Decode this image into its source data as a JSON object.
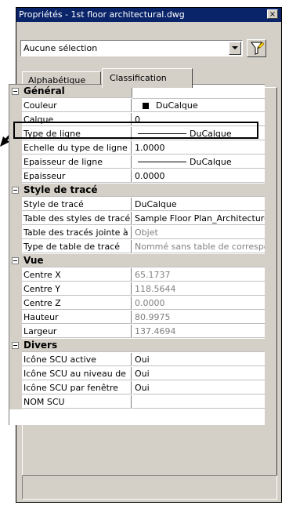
{
  "window": {
    "title": "Propriétés - 1st floor architectural.dwg",
    "close_glyph": "×"
  },
  "selection": {
    "value": "Aucune sélection"
  },
  "tabs": [
    {
      "label": "Alphabétique",
      "active": false
    },
    {
      "label": "Classification",
      "active": true
    }
  ],
  "categories": [
    {
      "label": "Général",
      "rows": [
        {
          "name": "Couleur",
          "value": "DuCalque",
          "kind": "color"
        },
        {
          "name": "Calque",
          "value": "0"
        },
        {
          "name": "Type de ligne",
          "value": "DuCalque",
          "kind": "line"
        },
        {
          "name": "Echelle du type de ligne",
          "value": "1.0000"
        },
        {
          "name": "Epaisseur de ligne",
          "value": "DuCalque",
          "kind": "line"
        },
        {
          "name": "Epaisseur",
          "value": "0.0000"
        }
      ]
    },
    {
      "label": "Style de tracé",
      "rows": [
        {
          "name": "Style de tracé",
          "value": "DuCalque"
        },
        {
          "name": "Table des styles de tracé",
          "value": "Sample Floor Plan_Architecture"
        },
        {
          "name": "Table des tracés jointe à",
          "value": "Objet",
          "gray": true
        },
        {
          "name": "Type de table de tracé",
          "value": "Nommé sans table de correspondance",
          "gray": true
        }
      ]
    },
    {
      "label": "Vue",
      "rows": [
        {
          "name": "Centre X",
          "value": "65.1737",
          "gray": true
        },
        {
          "name": "Centre Y",
          "value": "118.5644",
          "gray": true
        },
        {
          "name": "Centre Z",
          "value": "0.0000",
          "gray": true
        },
        {
          "name": "Hauteur",
          "value": "80.9975",
          "gray": true
        },
        {
          "name": "Largeur",
          "value": "137.4694",
          "gray": true
        }
      ]
    },
    {
      "label": "Divers",
      "rows": [
        {
          "name": "Icône SCU active",
          "value": "Oui"
        },
        {
          "name": "Icône SCU au niveau de",
          "value": "Oui"
        },
        {
          "name": "Icône SCU par fenêtre",
          "value": "Oui"
        },
        {
          "name": "NOM SCU",
          "value": ""
        }
      ]
    }
  ],
  "colors": {
    "titlebar": "#0a246a",
    "face": "#d4d0c8",
    "disabled_text": "#808080"
  },
  "icons": {
    "filter": "quick-select-filter-icon",
    "dropdown": "chevron-down-icon",
    "toggle": "collapse-minus-icon"
  }
}
